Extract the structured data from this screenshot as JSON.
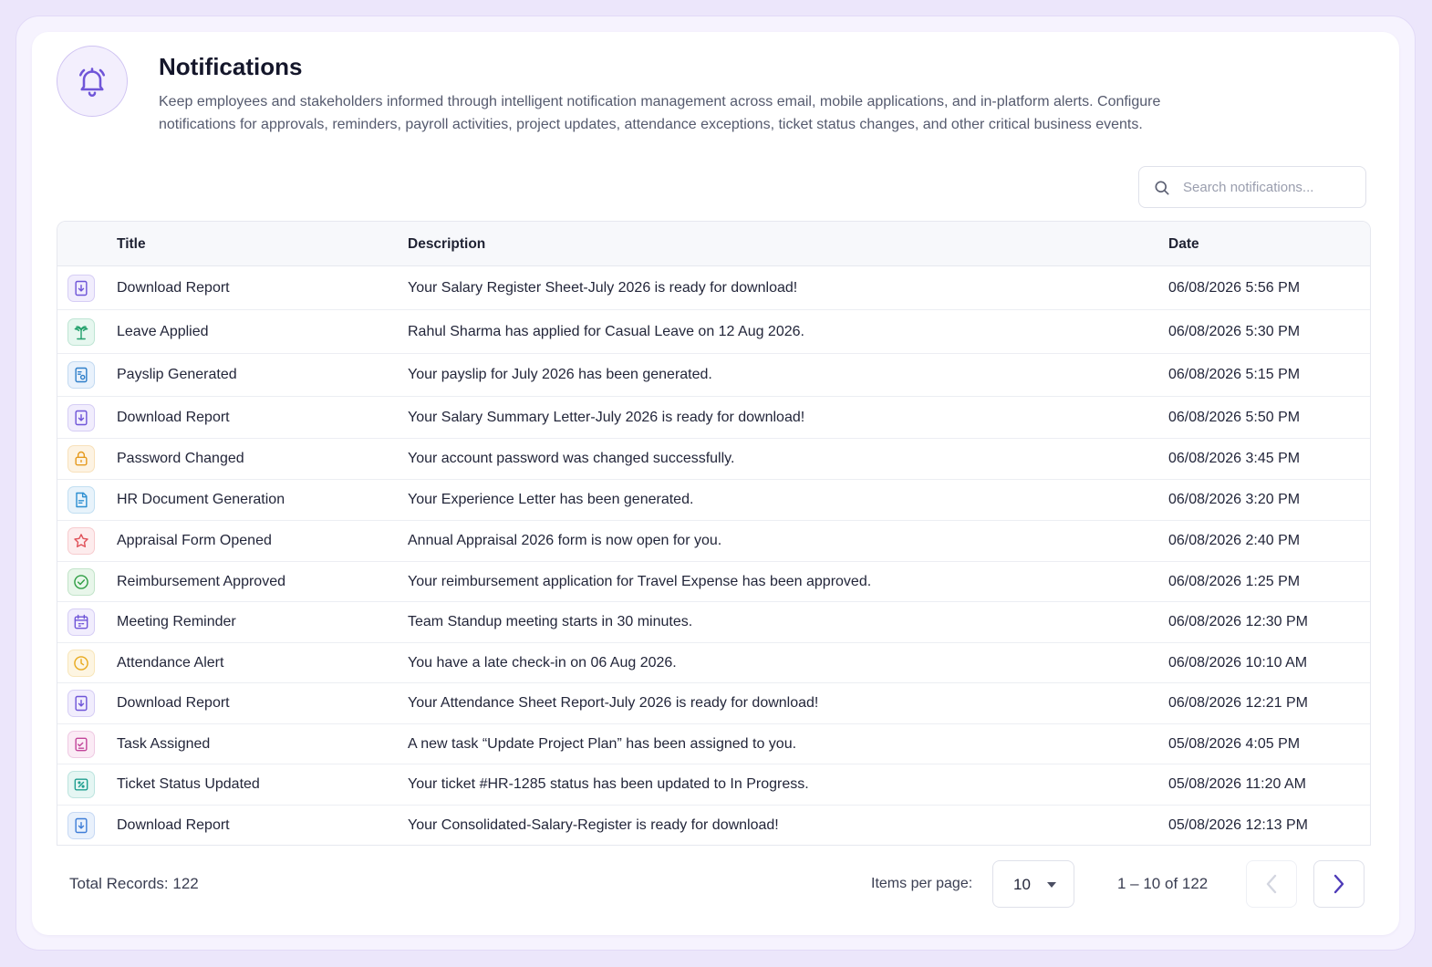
{
  "header": {
    "title": "Notifications",
    "description": "Keep employees and stakeholders informed through intelligent notification management across email, mobile applications, and in-platform alerts. Configure notifications for approvals, reminders, payroll activities, project updates, attendance exceptions, ticket status changes, and other critical business events.",
    "icon": "bell-icon"
  },
  "search": {
    "placeholder": "Search notifications..."
  },
  "table": {
    "columns": {
      "title": "Title",
      "description": "Description",
      "date": "Date"
    },
    "rows": [
      {
        "icon": "download-icon",
        "color": "#6f55d8",
        "bg": "#f1edfd",
        "title": "Download Report",
        "description": "Your Salary Register Sheet-July 2026 is ready for download!",
        "date": "06/08/2026 5:56 PM"
      },
      {
        "icon": "palm-tree-icon",
        "color": "#22a06b",
        "bg": "#e6f7ef",
        "title": "Leave Applied",
        "description": "Rahul Sharma has applied for Casual Leave on 12 Aug 2026.",
        "date": "06/08/2026 5:30 PM"
      },
      {
        "icon": "payslip-icon",
        "color": "#2f7fc9",
        "bg": "#e9f2fc",
        "title": "Payslip Generated",
        "description": "Your payslip for July 2026 has been generated.",
        "date": "06/08/2026 5:15 PM"
      },
      {
        "icon": "download-icon",
        "color": "#6f55d8",
        "bg": "#f1edfd",
        "title": "Download Report",
        "description": "Your Salary Summary Letter-July 2026 is ready for download!",
        "date": "06/08/2026 5:50 PM"
      },
      {
        "icon": "lock-icon",
        "color": "#e59a1f",
        "bg": "#fdf3e3",
        "title": "Password Changed",
        "description": "Your account password was changed successfully.",
        "date": "06/08/2026 3:45 PM"
      },
      {
        "icon": "document-icon",
        "color": "#2d8fd1",
        "bg": "#e8f3fb",
        "title": "HR Document Generation",
        "description": "Your Experience Letter has been generated.",
        "date": "06/08/2026 3:20 PM"
      },
      {
        "icon": "star-icon",
        "color": "#e0525a",
        "bg": "#fdeced",
        "title": "Appraisal Form Opened",
        "description": "Annual Appraisal 2026 form is now open for you.",
        "date": "06/08/2026 2:40 PM"
      },
      {
        "icon": "check-circle-icon",
        "color": "#2f9e44",
        "bg": "#e8f6ea",
        "title": "Reimbursement Approved",
        "description": "Your reimbursement application for Travel Expense has been approved.",
        "date": "06/08/2026 1:25 PM"
      },
      {
        "icon": "calendar-icon",
        "color": "#6f55d8",
        "bg": "#f1edfd",
        "title": "Meeting Reminder",
        "description": "Team Standup meeting starts in 30 minutes.",
        "date": "06/08/2026 12:30 PM"
      },
      {
        "icon": "clock-icon",
        "color": "#e8a91c",
        "bg": "#fdf5e2",
        "title": "Attendance Alert",
        "description": "You have a late check-in on 06 Aug 2026.",
        "date": "06/08/2026 10:10 AM"
      },
      {
        "icon": "download-icon",
        "color": "#6f55d8",
        "bg": "#f1edfd",
        "title": "Download Report",
        "description": "Your Attendance Sheet Report-July 2026 is ready for download!",
        "date": "06/08/2026 12:21 PM"
      },
      {
        "icon": "task-icon",
        "color": "#c2459a",
        "bg": "#fbebf5",
        "title": "Task Assigned",
        "description": "A new task “Update Project Plan” has been assigned to you.",
        "date": "05/08/2026 4:05 PM"
      },
      {
        "icon": "ticket-icon",
        "color": "#1f9e8f",
        "bg": "#e5f6f3",
        "title": "Ticket Status Updated",
        "description": "Your ticket #HR-1285 status has been updated to In Progress.",
        "date": "05/08/2026 11:20 AM"
      },
      {
        "icon": "download-icon",
        "color": "#3f7ed8",
        "bg": "#e9f1fc",
        "title": "Download Report",
        "description": "Your Consolidated-Salary-Register is ready for download!",
        "date": "05/08/2026 12:13 PM"
      }
    ]
  },
  "footer": {
    "total_records": "Total Records: 122",
    "items_per_page_label": "Items per page:",
    "items_per_page_value": "10",
    "range": "1 – 10 of 122"
  },
  "colors": {
    "accent": "#6f55d8",
    "background": "#ece6fb"
  }
}
